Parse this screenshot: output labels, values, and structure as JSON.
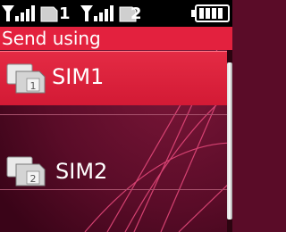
{
  "status_bar": {
    "sim1_signal_icon": "signal-bars-icon",
    "sim1_number": "1",
    "sim2_signal_icon": "signal-bars-icon",
    "sim2_number": "2",
    "battery_icon": "battery-full-icon"
  },
  "header": {
    "title": "Send using"
  },
  "options": [
    {
      "label": "SIM1",
      "icon": "sim-card-1-icon",
      "icon_number": "1",
      "selected": true
    },
    {
      "label": "SIM2",
      "icon": "sim-card-2-icon",
      "icon_number": "2",
      "selected": false
    }
  ],
  "colors": {
    "highlight": "#e3213e",
    "background": "#5a0c28",
    "status_bar": "#000000"
  }
}
